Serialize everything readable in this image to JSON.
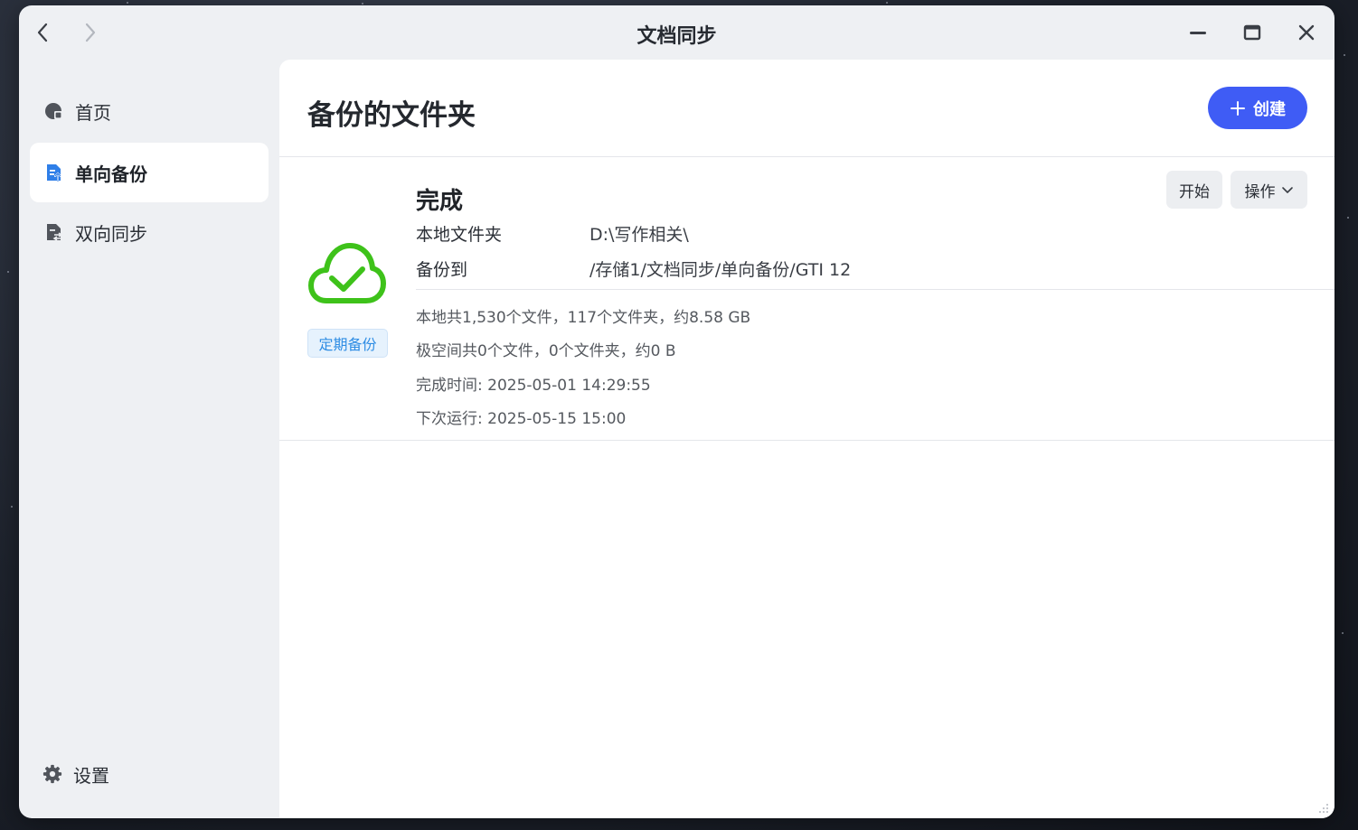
{
  "window": {
    "title": "文档同步"
  },
  "sidebar": {
    "items": [
      {
        "label": "首页",
        "icon": "home-icon",
        "active": false
      },
      {
        "label": "单向备份",
        "icon": "one-way-backup-icon",
        "active": true
      },
      {
        "label": "双向同步",
        "icon": "two-way-sync-icon",
        "active": false
      }
    ],
    "settings_label": "设置"
  },
  "main": {
    "title": "备份的文件夹",
    "create_label": "创建"
  },
  "task": {
    "status": "完成",
    "schedule_badge": "定期备份",
    "local_folder_label": "本地文件夹",
    "local_folder_value": "D:\\写作相关\\",
    "backup_to_label": "备份到",
    "backup_to_value": "/存储1/文档同步/单向备份/GTI 12",
    "local_stats": "本地共1,530个文件，117个文件夹，约8.58 GB",
    "remote_stats": "极空间共0个文件，0个文件夹，约0 B",
    "finish_time": "完成时间: 2025-05-01 14:29:55",
    "next_run": "下次运行: 2025-05-15 15:00",
    "start_label": "开始",
    "ops_label": "操作"
  },
  "colors": {
    "accent": "#3f5cf5",
    "success": "#3ec21a",
    "badge_text": "#2f8de4",
    "sidebar_active_icon": "#2f7fe8"
  }
}
